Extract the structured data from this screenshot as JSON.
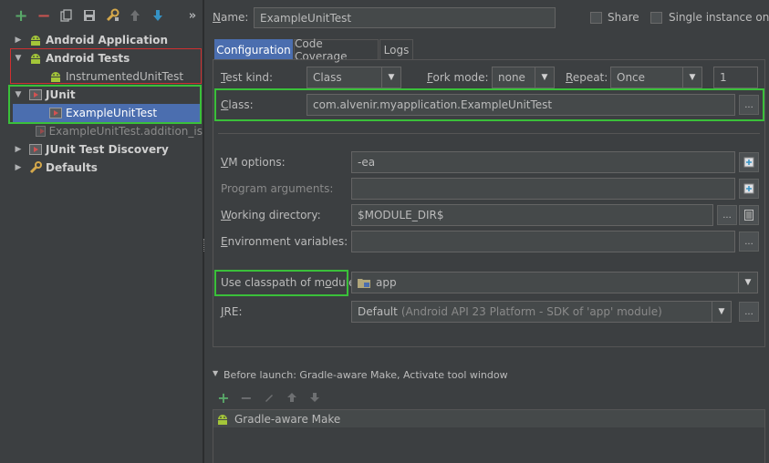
{
  "toolbar": {
    "add": "+",
    "remove": "−",
    "more": "»"
  },
  "tree": {
    "android_application": "Android Application",
    "android_tests": "Android Tests",
    "instrumented_unit_test": "InstrumentedUnitTest",
    "junit": "JUnit",
    "example_unit_test": "ExampleUnitTest",
    "example_unit_test_addition": "ExampleUnitTest.addition_is",
    "junit_test_discovery": "JUnit Test Discovery",
    "defaults": "Defaults"
  },
  "header": {
    "name_label": "Name:",
    "name_value": "ExampleUnitTest",
    "share_label": "Share",
    "single_instance_label": "Single instance only"
  },
  "tabs": {
    "configuration": "Configuration",
    "code_coverage": "Code Coverage",
    "logs": "Logs"
  },
  "config": {
    "test_kind_label": "Test kind:",
    "test_kind_value": "Class",
    "fork_mode_label": "Fork mode:",
    "fork_mode_value": "none",
    "repeat_label": "Repeat:",
    "repeat_value": "Once",
    "repeat_count": "1",
    "class_label": "Class:",
    "class_value": "com.alvenir.myapplication.ExampleUnitTest",
    "vm_options_label": "VM options:",
    "vm_options_value": "-ea",
    "program_arguments_label": "Program arguments:",
    "program_arguments_value": "",
    "working_directory_label": "Working directory:",
    "working_directory_value": "$MODULE_DIR$",
    "environment_variables_label": "Environment variables:",
    "environment_variables_value": "",
    "use_classpath_label": "Use classpath of module:",
    "use_classpath_value": "app",
    "jre_label": "JRE:",
    "jre_value": "Default",
    "jre_detail": "(Android API 23 Platform - SDK of 'app' module)",
    "ellipsis": "..."
  },
  "before_launch": {
    "title": "Before launch: Gradle-aware Make, Activate tool window",
    "items": [
      "Gradle-aware Make"
    ]
  },
  "colors": {
    "background": "#3c3f41",
    "accent_tab": "#4b6eaf",
    "selection": "#4b6eaf",
    "highlight_green": "#3ac03a",
    "highlight_red": "#d03030",
    "android_green": "#a4c639"
  }
}
